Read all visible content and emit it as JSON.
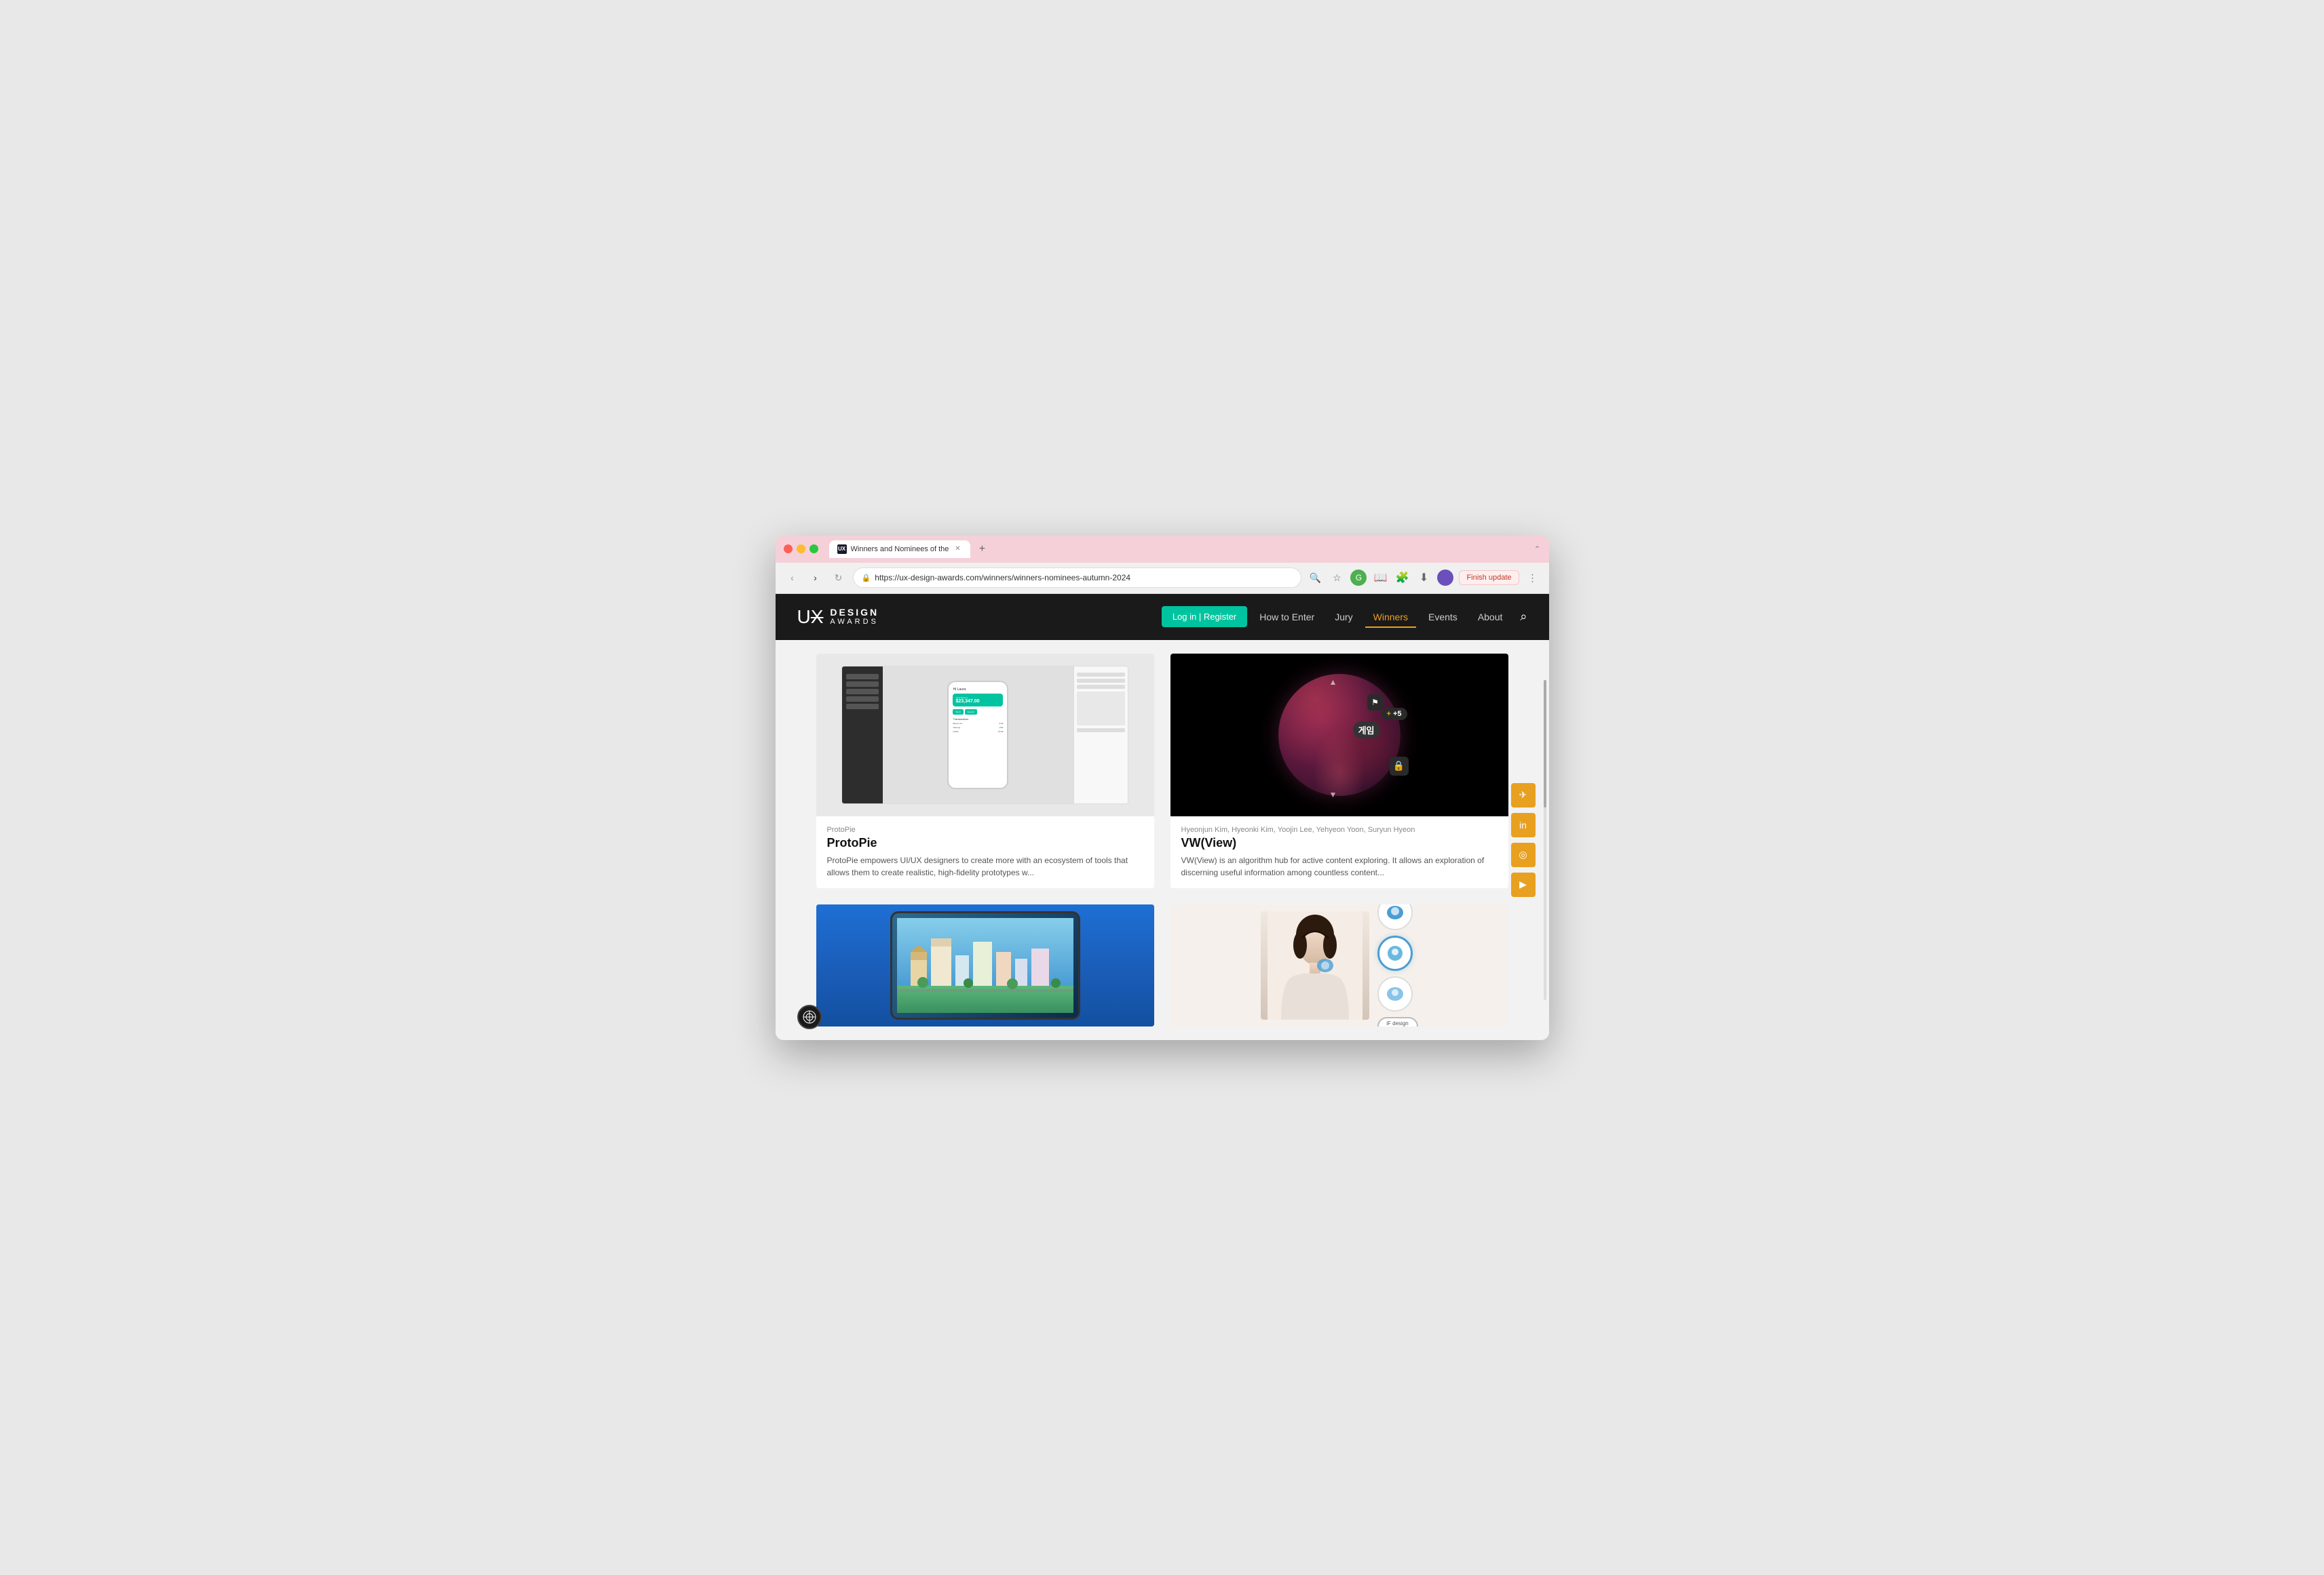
{
  "browser": {
    "tab": {
      "favicon_label": "UX",
      "title": "Winners and Nominees of the"
    },
    "new_tab_label": "+",
    "window_controls_label": "⌃",
    "address_bar": {
      "url": "https://ux-design-awards.com/winners/winners-nominees-autumn-2024",
      "lock_icon": "🔒"
    },
    "nav_buttons": {
      "back": "‹",
      "forward": "›",
      "refresh": "↻"
    },
    "finish_update_label": "Finish update"
  },
  "site": {
    "logo": {
      "ux": "UX",
      "design": "DESIGN",
      "awards": "AWARDS"
    },
    "nav": {
      "login_label": "Log in | Register",
      "links": [
        "How to Enter",
        "Jury",
        "Winners",
        "Events",
        "About"
      ]
    },
    "page_title": "Winners and Nominees of the"
  },
  "cards": [
    {
      "brand": "ProtoPie",
      "title": "ProtoPie",
      "description": "ProtoPie empowers UI/UX designers to create more with an ecosystem of tools that allows them to create realistic, high-fidelity prototypes w...",
      "phone": {
        "greeting": "Hi Laura",
        "balance_label": "Total Balance",
        "balance_amount": "$23,347.00",
        "btn1": "Send",
        "btn2": "Deposit",
        "transactions_label": "Transactions",
        "transactions": [
          {
            "name": "Beans Ltd",
            "amount": "-5.00",
            "type": "neg"
          },
          {
            "name": "Savings Int.",
            "amount": "200.00",
            "type": "pos"
          },
          {
            "name": "Netflix Inc.",
            "amount": "-12.99",
            "type": "neg"
          },
          {
            "name": "Netflix Inc.",
            "amount": "+49.00",
            "type": "pos"
          }
        ]
      }
    },
    {
      "brand": "Hyeonjun Kim, Hyeonki Kim, Yoojin Lee, Yehyeon Yoon, Suryun Hyeon",
      "title": "VW(View)",
      "description": "VW(View) is an algorithm hub for active content exploring. It allows an exploration of discerning useful information among countless content...",
      "badge_score": "+5",
      "badge_korean": "게임"
    }
  ],
  "bottom_cards": [
    {
      "brand": "",
      "title": "",
      "description": ""
    },
    {
      "brand": "",
      "title": "",
      "description": ""
    }
  ],
  "social": {
    "telegram_icon": "✈",
    "linkedin_icon": "in",
    "instagram_icon": "◎",
    "youtube_icon": "▶"
  }
}
